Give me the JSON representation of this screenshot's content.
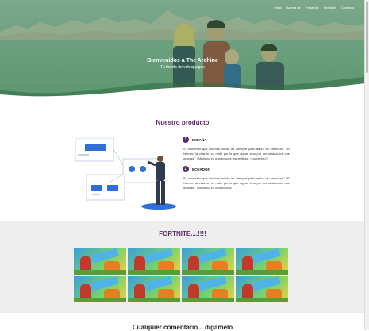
{
  "nav": {
    "items": [
      "Inicio",
      "Acerca de",
      "Portafolio",
      "Servicios",
      "Contacto"
    ]
  },
  "hero": {
    "title": "Bienvenidos a The Archine",
    "subtitle": "Tu tienda de videojuegos"
  },
  "product": {
    "title": "Nuestro producto",
    "items": [
      {
        "num": "1",
        "label": "ESPAÑA",
        "text": "\"El momento que da más miedo es siempre justo antes de empezar.\" \"El éxito en la vida no se mide por lo que logras sino por los obstáculos que superas.\" «Mañana es una excusa maravillosa, ¿no creéis?»"
      },
      {
        "num": "2",
        "label": "ECUADOR",
        "text": "\"El momento que da más miedo es siempre justo antes de empezar.\" \"El éxito en la vida no se mide por lo que logras sino por los obstáculos que superas.\" «Mañana es una excusa"
      }
    ]
  },
  "gallery": {
    "title": "FORTNITE....!!!!",
    "count": 8
  },
  "next_section": {
    "title": "Cualquier comentario... dígamelo"
  },
  "colors": {
    "accent": "#5b2a6e",
    "hero_tint": "#3c8c5a",
    "illustration_blue": "#2f6fd6"
  }
}
